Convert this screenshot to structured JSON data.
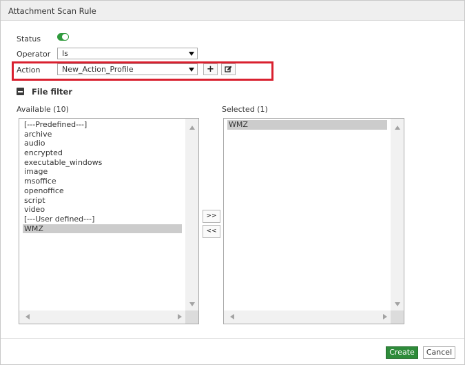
{
  "dialog": {
    "title": "Attachment Scan Rule"
  },
  "form": {
    "status_label": "Status",
    "status_on": true,
    "operator_label": "Operator",
    "operator_value": "Is",
    "action_label": "Action",
    "action_value": "New_Action_Profile",
    "add_symbol": "+",
    "edit_symbol": "✎"
  },
  "file_filter": {
    "section_title": "File filter",
    "available_label": "Available (10)",
    "selected_label": "Selected (1)",
    "available_items": [
      "[---Predefined---]",
      "archive",
      "audio",
      "encrypted",
      "executable_windows",
      "image",
      "msoffice",
      "openoffice",
      "script",
      "video",
      "[---User defined---]",
      "WMZ"
    ],
    "selected_items": [
      "WMZ"
    ],
    "move_right_label": ">>",
    "move_left_label": "<<"
  },
  "footer": {
    "create_label": "Create",
    "cancel_label": "Cancel"
  },
  "colors": {
    "accent_green": "#2e8b3a",
    "highlight_red": "#d9202f"
  }
}
